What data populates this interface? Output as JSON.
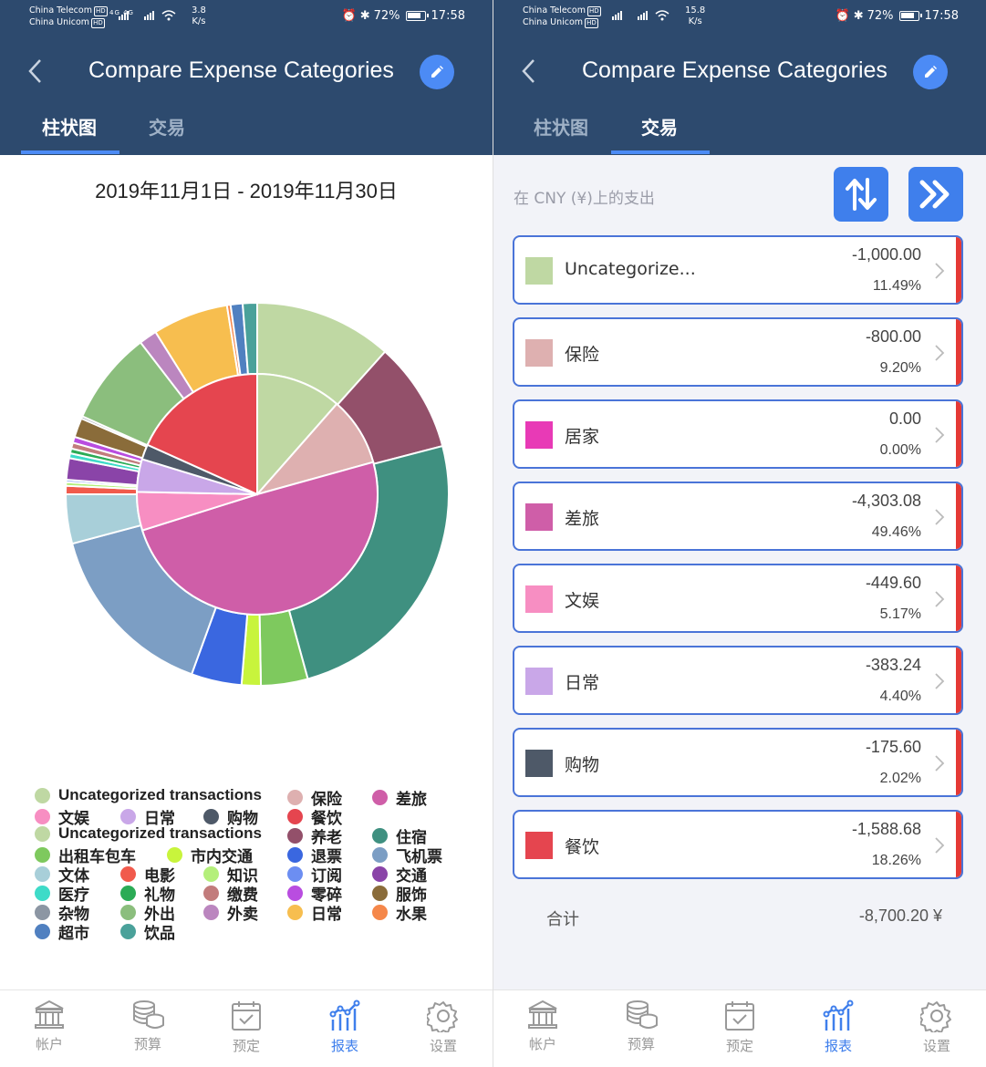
{
  "status": {
    "carrier1": "China Telecom",
    "carrier2": "China Unicom",
    "hd": "HD",
    "signal": "4G 4G",
    "left_speed_value": "3.8",
    "right_speed_value": "15.8",
    "speed_unit": "K/s",
    "battery": "72%",
    "time": "17:58"
  },
  "header": {
    "title": "Compare Expense Categories",
    "tabs": [
      "柱状图",
      "交易"
    ]
  },
  "left": {
    "date_range": "2019年11月1日 - 2019年11月30日",
    "legend": [
      {
        "label": "Uncategorized transactions",
        "color": "#bfd8a3"
      },
      {
        "label": "保险",
        "color": "#deb0b0"
      },
      {
        "label": "差旅",
        "color": "#cf5ea8"
      },
      {
        "label": "文娱",
        "color": "#f78ec2"
      },
      {
        "label": "日常",
        "color": "#c9a7e8"
      },
      {
        "label": "购物",
        "color": "#4e5968"
      },
      {
        "label": "餐饮",
        "color": "#e5454f"
      },
      {
        "label": "Uncategorized transactions",
        "color": "#bfd8a3"
      },
      {
        "label": "养老",
        "color": "#93506a"
      },
      {
        "label": "住宿",
        "color": "#3f9080"
      },
      {
        "label": "出租车包车",
        "color": "#7ec95e"
      },
      {
        "label": "市内交通",
        "color": "#c8f43c"
      },
      {
        "label": "退票",
        "color": "#3a67e0"
      },
      {
        "label": "飞机票",
        "color": "#7c9ec4"
      },
      {
        "label": "文体",
        "color": "#a8cfd9"
      },
      {
        "label": "电影",
        "color": "#f15a4c"
      },
      {
        "label": "知识",
        "color": "#b4ef7b"
      },
      {
        "label": "订阅",
        "color": "#6c8ef2"
      },
      {
        "label": "交通",
        "color": "#8a44a8"
      },
      {
        "label": "医疗",
        "color": "#3edbc8"
      },
      {
        "label": "礼物",
        "color": "#2bab55"
      },
      {
        "label": "缴费",
        "color": "#c27c7c"
      },
      {
        "label": "零碎",
        "color": "#b94de0"
      },
      {
        "label": "服饰",
        "color": "#8a6c3a"
      },
      {
        "label": "杂物",
        "color": "#8c96a3"
      },
      {
        "label": "外出",
        "color": "#8bbe7d"
      },
      {
        "label": "外卖",
        "color": "#bb86bf"
      },
      {
        "label": "日常",
        "color": "#f7be4f"
      },
      {
        "label": "水果",
        "color": "#f5874a"
      },
      {
        "label": "超市",
        "color": "#5080c0"
      },
      {
        "label": "饮品",
        "color": "#4aa19a"
      }
    ]
  },
  "chart_data": {
    "type": "pie",
    "note_inner": "inner ring: parent categories",
    "inner": [
      {
        "name": "Uncategorized transactions",
        "value": 11.49,
        "color": "#bfd8a3"
      },
      {
        "name": "保险",
        "value": 9.2,
        "color": "#deb0b0"
      },
      {
        "name": "差旅",
        "value": 49.46,
        "color": "#cf5ea8"
      },
      {
        "name": "文娱",
        "value": 5.17,
        "color": "#f78ec2"
      },
      {
        "name": "日常",
        "value": 4.4,
        "color": "#c9a7e8"
      },
      {
        "name": "购物",
        "value": 2.02,
        "color": "#4e5968"
      },
      {
        "name": "餐饮",
        "value": 18.26,
        "color": "#e5454f"
      }
    ],
    "outer": [
      {
        "name": "Uncategorized transactions",
        "value": 11.49,
        "color": "#bfd8a3"
      },
      {
        "name": "养老",
        "value": 9.2,
        "color": "#93506a"
      },
      {
        "name": "住宿",
        "value": 24.5,
        "color": "#3f9080"
      },
      {
        "name": "出租车包车",
        "value": 3.9,
        "color": "#7ec95e"
      },
      {
        "name": "市内交通",
        "value": 1.6,
        "color": "#c8f43c"
      },
      {
        "name": "退票",
        "value": 4.2,
        "color": "#3a67e0"
      },
      {
        "name": "飞机票",
        "value": 15.1,
        "color": "#7c9ec4"
      },
      {
        "name": "文体",
        "value": 4.1,
        "color": "#a8cfd9"
      },
      {
        "name": "电影",
        "value": 0.7,
        "color": "#f15a4c"
      },
      {
        "name": "知识",
        "value": 0.3,
        "color": "#b4ef7b"
      },
      {
        "name": "订阅",
        "value": 0.2,
        "color": "#6c8ef2"
      },
      {
        "name": "交通",
        "value": 1.8,
        "color": "#8a44a8"
      },
      {
        "name": "医疗",
        "value": 0.4,
        "color": "#3edbc8"
      },
      {
        "name": "礼物",
        "value": 0.4,
        "color": "#2bab55"
      },
      {
        "name": "缴费",
        "value": 0.5,
        "color": "#c27c7c"
      },
      {
        "name": "零碎",
        "value": 0.5,
        "color": "#b94de0"
      },
      {
        "name": "服饰",
        "value": 1.6,
        "color": "#8a6c3a"
      },
      {
        "name": "杂物",
        "value": 0.2,
        "color": "#8c96a3"
      },
      {
        "name": "外出",
        "value": 7.8,
        "color": "#8bbe7d"
      },
      {
        "name": "外卖",
        "value": 1.5,
        "color": "#bb86bf"
      },
      {
        "name": "日常",
        "value": 6.3,
        "color": "#f7be4f"
      },
      {
        "name": "水果",
        "value": 0.3,
        "color": "#f5874a"
      },
      {
        "name": "超市",
        "value": 1.0,
        "color": "#5080c0"
      },
      {
        "name": "饮品",
        "value": 1.2,
        "color": "#4aa19a"
      }
    ]
  },
  "right": {
    "caption": "在 CNY (¥)上的支出",
    "rows": [
      {
        "name": "Uncategorize...",
        "amount": "-1,000.00",
        "percent": "11.49%",
        "color": "#bfd8a3"
      },
      {
        "name": "保险",
        "amount": "-800.00",
        "percent": "9.20%",
        "color": "#deb0b0"
      },
      {
        "name": "居家",
        "amount": "0.00",
        "percent": "0.00%",
        "color": "#e83ab6"
      },
      {
        "name": "差旅",
        "amount": "-4,303.08",
        "percent": "49.46%",
        "color": "#cf5ea8"
      },
      {
        "name": "文娱",
        "amount": "-449.60",
        "percent": "5.17%",
        "color": "#f78ec2"
      },
      {
        "name": "日常",
        "amount": "-383.24",
        "percent": "4.40%",
        "color": "#c9a7e8"
      },
      {
        "name": "购物",
        "amount": "-175.60",
        "percent": "2.02%",
        "color": "#4e5968"
      },
      {
        "name": "餐饮",
        "amount": "-1,588.68",
        "percent": "18.26%",
        "color": "#e5454f"
      }
    ],
    "total_label": "合计",
    "total_value": "-8,700.20 ¥"
  },
  "nav": {
    "items": [
      {
        "label": "帐户",
        "icon": "bank-icon"
      },
      {
        "label": "预算",
        "icon": "coins-icon"
      },
      {
        "label": "预定",
        "icon": "calendar-check-icon"
      },
      {
        "label": "报表",
        "icon": "chart-icon"
      },
      {
        "label": "设置",
        "icon": "gear-icon"
      }
    ],
    "active_index": 3
  }
}
